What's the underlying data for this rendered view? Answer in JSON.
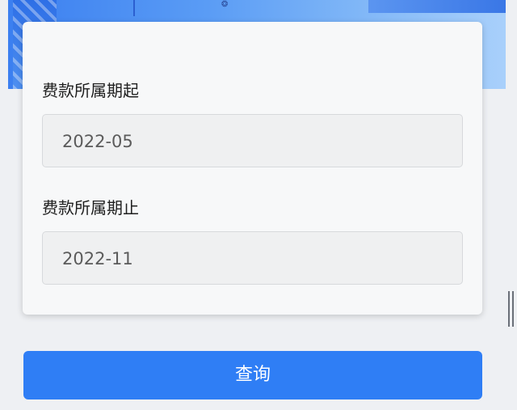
{
  "form": {
    "start_label": "费款所属期起",
    "start_value": "2022-05",
    "end_label": "费款所属期止",
    "end_value": "2022-11"
  },
  "actions": {
    "query_label": "查询"
  },
  "colors": {
    "primary": "#2f7ef5",
    "banner": "#3b7ff0",
    "input_bg": "#eff0f1"
  }
}
